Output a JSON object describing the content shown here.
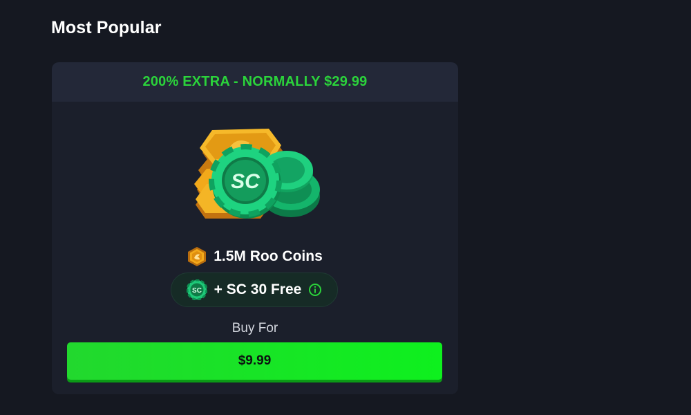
{
  "section": {
    "title": "Most Popular"
  },
  "offer": {
    "header": "200% EXTRA - NORMALLY $29.99",
    "coins_label": "1.5M Roo Coins",
    "coin_icon": "roo-coin-icon",
    "sc_label": "+ SC 30 Free",
    "sc_icon": "sc-coin-icon",
    "sc_badge_text": "SC",
    "info_icon": "info-icon",
    "art_badge_text": "SC",
    "buy_for_label": "Buy For",
    "price": "$9.99"
  },
  "colors": {
    "background": "#151821",
    "card": "#1b1f2b",
    "card_header": "#232838",
    "accent_green": "#2bd33b",
    "button_green": "#0ef01e",
    "coin_gold": "#f2a91a"
  }
}
